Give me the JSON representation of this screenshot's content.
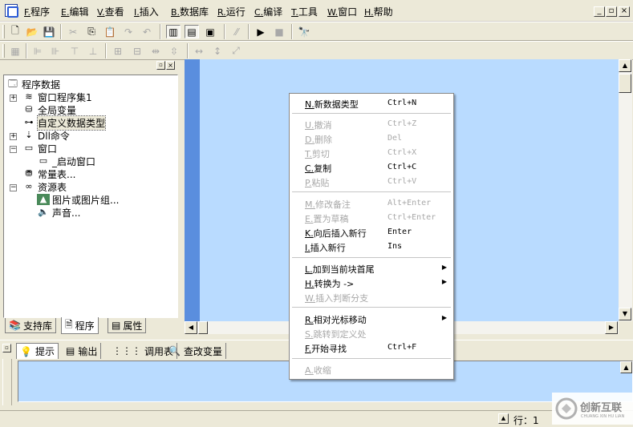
{
  "menubar": {
    "items": [
      {
        "key": "F.",
        "label": "程序"
      },
      {
        "key": "E.",
        "label": "编辑"
      },
      {
        "key": "V.",
        "label": "查看"
      },
      {
        "key": "I.",
        "label": "插入"
      },
      {
        "key": "B.",
        "label": "数据库"
      },
      {
        "key": "R.",
        "label": "运行"
      },
      {
        "key": "C.",
        "label": "编译"
      },
      {
        "key": "T.",
        "label": "工具"
      },
      {
        "key": "W.",
        "label": "窗口"
      },
      {
        "key": "H.",
        "label": "帮助"
      }
    ]
  },
  "tree": {
    "root": "程序数据",
    "items": [
      {
        "label": "窗口程序集1"
      },
      {
        "label": "全局变量"
      },
      {
        "label": "自定义数据类型"
      },
      {
        "label": "Dll命令"
      },
      {
        "label": "窗口"
      },
      {
        "label": "_启动窗口"
      },
      {
        "label": "常量表..."
      },
      {
        "label": "资源表"
      },
      {
        "label": "图片或图片组..."
      },
      {
        "label": "声音..."
      }
    ]
  },
  "left_tabs": [
    {
      "label": "支持库"
    },
    {
      "label": "程序"
    },
    {
      "label": "属性"
    }
  ],
  "bottom_tabs": [
    {
      "label": "提示"
    },
    {
      "label": "输出"
    },
    {
      "label": "调用表"
    },
    {
      "label": "查改变量"
    }
  ],
  "status": {
    "line": "行：1"
  },
  "context_menu": {
    "items": [
      {
        "key": "N.",
        "label": "新数据类型",
        "shortcut": "Ctrl+N",
        "disabled": false
      },
      {
        "key": "U.",
        "label": "撤消",
        "shortcut": "Ctrl+Z",
        "disabled": true
      },
      {
        "key": "D.",
        "label": "删除",
        "shortcut": "Del",
        "disabled": true
      },
      {
        "key": "T.",
        "label": "剪切",
        "shortcut": "Ctrl+X",
        "disabled": true
      },
      {
        "key": "C.",
        "label": "复制",
        "shortcut": "Ctrl+C",
        "disabled": false
      },
      {
        "key": "P.",
        "label": "粘贴",
        "shortcut": "Ctrl+V",
        "disabled": true
      },
      {
        "key": "M.",
        "label": "修改备注",
        "shortcut": "Alt+Enter",
        "disabled": true
      },
      {
        "key": "E.",
        "label": "置为草稿",
        "shortcut": "Ctrl+Enter",
        "disabled": true
      },
      {
        "key": "K.",
        "label": "向后插入新行",
        "shortcut": "Enter",
        "disabled": false
      },
      {
        "key": "I.",
        "label": "插入新行",
        "shortcut": "Ins",
        "disabled": false
      },
      {
        "key": "L.",
        "label": "加到当前块首尾",
        "shortcut": "",
        "disabled": false,
        "submenu": true
      },
      {
        "key": "H.",
        "label": "转换为 ->",
        "shortcut": "",
        "disabled": false,
        "submenu": true
      },
      {
        "key": "W.",
        "label": "插入判断分支",
        "shortcut": "",
        "disabled": true
      },
      {
        "key": "R.",
        "label": "相对光标移动",
        "shortcut": "",
        "disabled": false,
        "submenu": true
      },
      {
        "key": "S.",
        "label": "跳转到定义处",
        "shortcut": "",
        "disabled": true
      },
      {
        "key": "F.",
        "label": "开始寻找",
        "shortcut": "Ctrl+F",
        "disabled": false
      },
      {
        "key": "A.",
        "label": "收缩",
        "shortcut": "",
        "disabled": true
      }
    ]
  },
  "watermark": {
    "cn": "创新互联",
    "en": "CHUANG XIN HU LIAN"
  },
  "colors": {
    "editor_bg": "#b9dbff",
    "gutter": "#5a8ede",
    "chrome": "#ece9d8"
  }
}
